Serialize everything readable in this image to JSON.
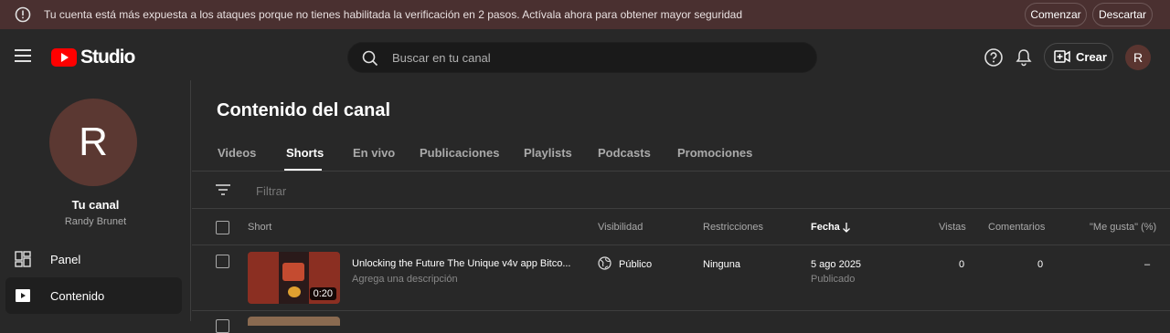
{
  "banner": {
    "message": "Tu cuenta está más expuesta a los ataques porque no tienes habilitada la verificación en 2 pasos. Actívala ahora para obtener mayor seguridad",
    "start_label": "Comenzar",
    "dismiss_label": "Descartar",
    "background": "#4a3030"
  },
  "header": {
    "logo_text": "Studio",
    "search_placeholder": "Buscar en tu canal",
    "create_label": "Crear",
    "avatar_initial": "R"
  },
  "sidebar": {
    "avatar_initial": "R",
    "channel_title": "Tu canal",
    "channel_name": "Randy Brunet",
    "items": [
      {
        "label": "Panel",
        "icon": "dashboard-icon",
        "active": false
      },
      {
        "label": "Contenido",
        "icon": "content-icon",
        "active": true
      }
    ]
  },
  "main": {
    "title": "Contenido del canal",
    "tabs": [
      {
        "label": "Videos",
        "active": false
      },
      {
        "label": "Shorts",
        "active": true
      },
      {
        "label": "En vivo",
        "active": false
      },
      {
        "label": "Publicaciones",
        "active": false
      },
      {
        "label": "Playlists",
        "active": false
      },
      {
        "label": "Podcasts",
        "active": false
      },
      {
        "label": "Promociones",
        "active": false
      }
    ],
    "filter_placeholder": "Filtrar",
    "columns": {
      "short": "Short",
      "visibility": "Visibilidad",
      "restrictions": "Restricciones",
      "date": "Fecha",
      "views": "Vistas",
      "comments": "Comentarios",
      "likes": "\"Me gusta\" (%)"
    },
    "rows": [
      {
        "title": "Unlocking the Future The Unique v4v app Bitco...",
        "description": "Agrega una descripción",
        "duration": "0:20",
        "visibility": "Público",
        "restrictions": "Ninguna",
        "date": "5 ago 2025",
        "status": "Publicado",
        "views": "0",
        "comments": "0",
        "likes": "–"
      }
    ]
  },
  "colors": {
    "accent": "#ff0000",
    "background": "#282828",
    "search_bg": "#1a1a1a"
  }
}
